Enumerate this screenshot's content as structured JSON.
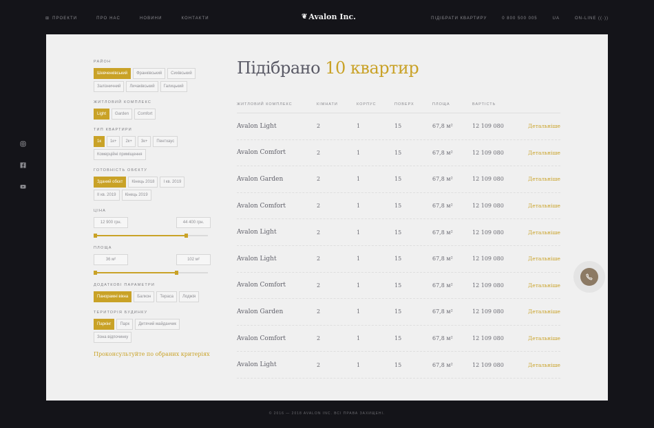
{
  "nav": {
    "left": [
      "ПРОЕКТИ",
      "ПРО НАС",
      "НОВИНИ",
      "КОНТАКТИ"
    ],
    "logo": "Avalon Inc.",
    "right": [
      "ПІДІБРАТИ КВАРТИРУ",
      "0 800 500 005",
      "UA",
      "ON-LINE"
    ]
  },
  "social": [
    "instagram-icon",
    "facebook-icon",
    "youtube-icon"
  ],
  "filters": {
    "district": {
      "label": "РАЙОН",
      "options": [
        "Шевченківський",
        "Франківський",
        "Сихівський",
        "Залізничний",
        "Личаківський",
        "Галицький"
      ],
      "active": [
        0
      ]
    },
    "complex": {
      "label": "ЖИТЛОВИЙ КОМПЛЕКС",
      "options": [
        "Light",
        "Garden",
        "Comfort"
      ],
      "active": [
        0
      ]
    },
    "type": {
      "label": "ТИП КВАРТИРИ",
      "options": [
        "1к",
        "1к+",
        "2к+",
        "3к+",
        "Пентхаус",
        "Комерційні приміщення"
      ],
      "active": [
        0
      ]
    },
    "readiness": {
      "label": "ГОТОВНІСТЬ ОБЄКТУ",
      "options": [
        "Зданий обєкт",
        "Кінець 2018",
        "І кв. 2019",
        "ІІ кв. 2019",
        "Кінець 2019"
      ],
      "active": [
        0
      ]
    },
    "price": {
      "label": "ЦІНА",
      "min": "12 900 грн.",
      "max": "44 400 грн.",
      "from": 0.0,
      "to": 0.82
    },
    "area": {
      "label": "ПЛОЩА",
      "min": "36 м²",
      "max": "102 м²",
      "from": 0.0,
      "to": 0.73
    },
    "extra": {
      "label": "ДОДАТКОВІ ПАРАМЕТРИ",
      "options": [
        "Панорамні вікна",
        "Балкон",
        "Тераса",
        "Лоджія"
      ],
      "active": [
        0
      ]
    },
    "territory": {
      "label": "ТЕРИТОРІЯ БУДИНКУ",
      "options": [
        "Паркінг",
        "Парк",
        "Дитячий майданчик",
        "Зона відпочинку"
      ],
      "active": [
        0
      ]
    },
    "consult": "Проконсультуйте по обраних критеріях"
  },
  "results": {
    "title_prefix": "Підібрано",
    "title_accent": "10 квартир",
    "columns": [
      "ЖИТЛОВИЙ КОМПЛЕКС",
      "КІМНАТИ",
      "КОРПУС",
      "ПОВЕРХ",
      "ПЛОЩА",
      "ВАРТІСТЬ"
    ],
    "rows": [
      {
        "name": "Avalon Light",
        "rooms": "2",
        "building": "1",
        "floor": "15",
        "area": "67,8 м²",
        "price": "12 109 080",
        "link": "Детальніше"
      },
      {
        "name": "Avalon Comfort",
        "rooms": "2",
        "building": "1",
        "floor": "15",
        "area": "67,8 м²",
        "price": "12 109 080",
        "link": "Детальніше"
      },
      {
        "name": "Avalon Garden",
        "rooms": "2",
        "building": "1",
        "floor": "15",
        "area": "67,8 м²",
        "price": "12 109 080",
        "link": "Детальніше"
      },
      {
        "name": "Avalon Comfort",
        "rooms": "2",
        "building": "1",
        "floor": "15",
        "area": "67,8 м²",
        "price": "12 109 080",
        "link": "Детальніше"
      },
      {
        "name": "Avalon Light",
        "rooms": "2",
        "building": "1",
        "floor": "15",
        "area": "67,8 м²",
        "price": "12 109 080",
        "link": "Детальніше"
      },
      {
        "name": "Avalon Light",
        "rooms": "2",
        "building": "1",
        "floor": "15",
        "area": "67,8 м²",
        "price": "12 109 080",
        "link": "Детальніше"
      },
      {
        "name": "Avalon Comfort",
        "rooms": "2",
        "building": "1",
        "floor": "15",
        "area": "67,8 м²",
        "price": "12 109 080",
        "link": "Детальніше"
      },
      {
        "name": "Avalon Garden",
        "rooms": "2",
        "building": "1",
        "floor": "15",
        "area": "67,8 м²",
        "price": "12 109 080",
        "link": "Детальніше"
      },
      {
        "name": "Avalon Comfort",
        "rooms": "2",
        "building": "1",
        "floor": "15",
        "area": "67,8 м²",
        "price": "12 109 080",
        "link": "Детальніше"
      },
      {
        "name": "Avalon Light",
        "rooms": "2",
        "building": "1",
        "floor": "15",
        "area": "67,8 м²",
        "price": "12 109 080",
        "link": "Детальніше"
      }
    ]
  },
  "call_button": {
    "icon": "phone-icon"
  },
  "footer": "© 2016 — 2018 AVALON INC. ВСІ ПРАВА ЗАХИЩЕНІ.",
  "colors": {
    "accent": "#c9a227",
    "background": "#141419",
    "card": "#f0f0f0"
  }
}
